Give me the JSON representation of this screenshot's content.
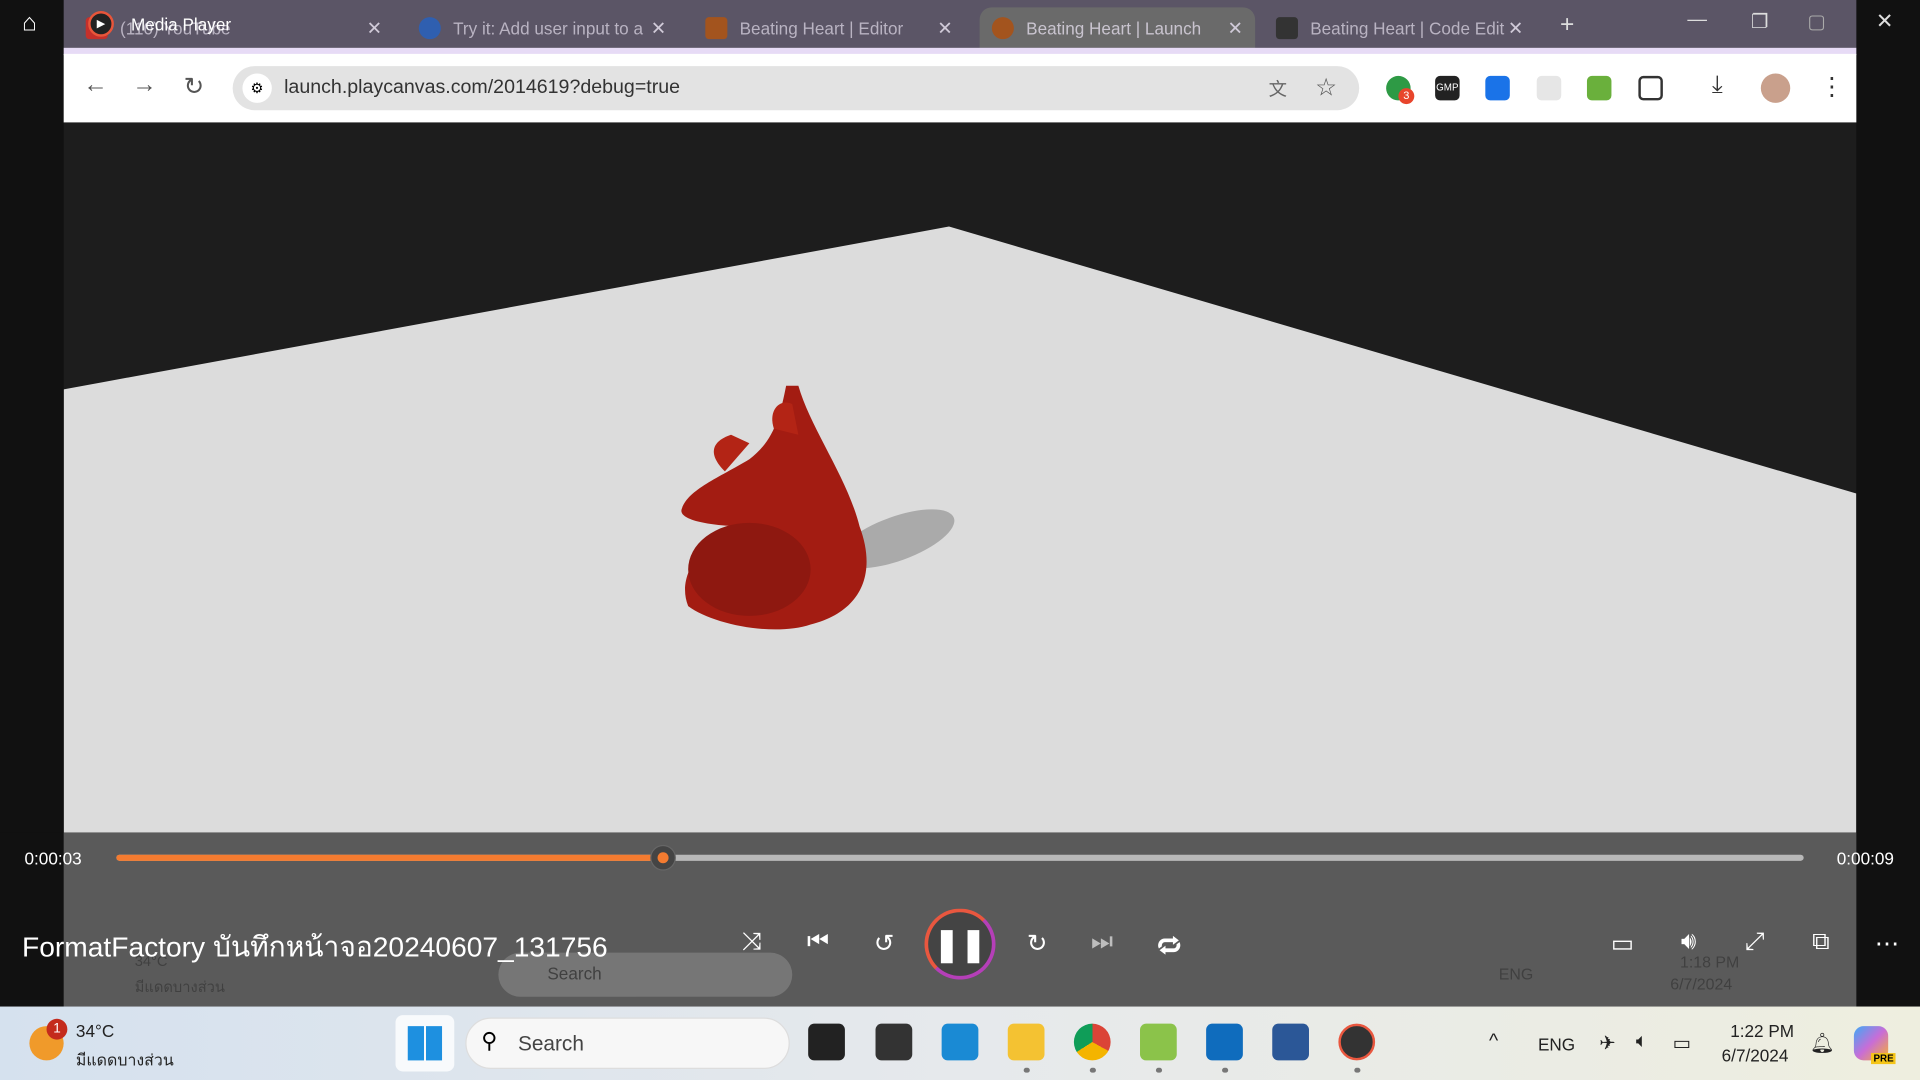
{
  "media_player": {
    "title": "Media Player",
    "file_title": "FormatFactory บันทึกหน้าจอ20240607_131756",
    "current_time": "0:00:03",
    "total_time": "0:00:09",
    "progress_fraction": 0.324
  },
  "browser": {
    "tabs": [
      {
        "label": "(110) YouTube",
        "active": false
      },
      {
        "label": "Try it: Add user input to a",
        "active": false
      },
      {
        "label": "Beating Heart | Editor",
        "active": false
      },
      {
        "label": "Beating Heart | Launch",
        "active": true
      },
      {
        "label": "Beating Heart | Code Edit",
        "active": false
      }
    ],
    "url": "launch.playcanvas.com/2014619?debug=true",
    "extension_badge": "3",
    "gmp_label": "GMP"
  },
  "ghost_taskbar": {
    "temp": "34°C",
    "weather": "มีแดดบางส่วน",
    "search": "Search",
    "lang": "ENG",
    "time": "1:18 PM",
    "date": "6/7/2024"
  },
  "taskbar": {
    "temp": "34°C",
    "weather": "มีแดดบางส่วน",
    "weather_badge": "1",
    "search": "Search",
    "lang": "ENG",
    "time": "1:22 PM",
    "date": "6/7/2024",
    "copilot_badge": "PRE"
  },
  "colors": {
    "accent": "#f47b30",
    "tabbar": "#5b5566",
    "floor": "#dcdcdc",
    "heart": "#a31c12"
  }
}
